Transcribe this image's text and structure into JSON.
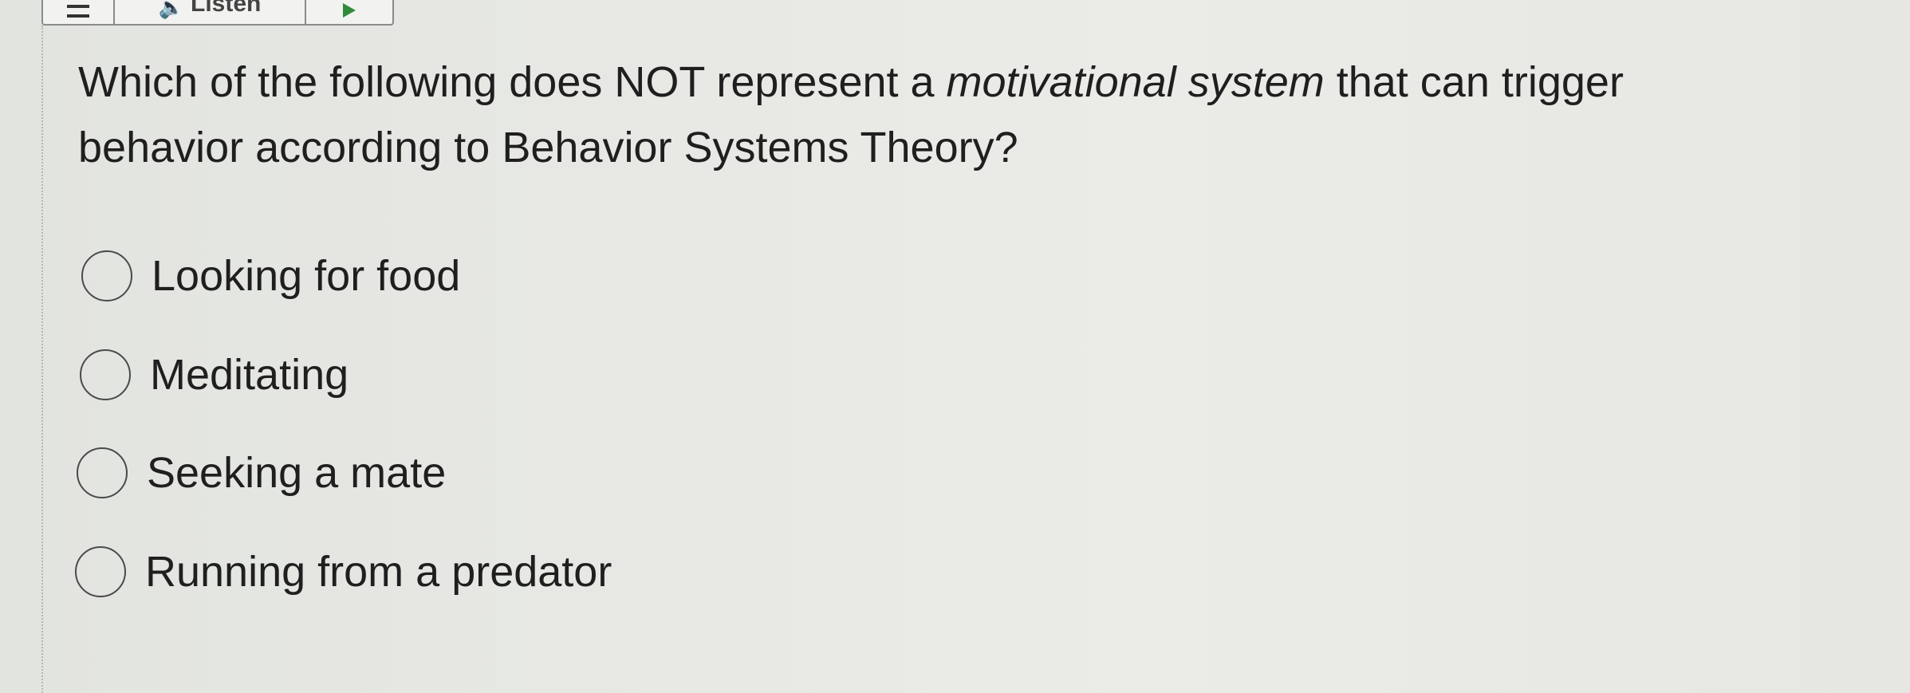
{
  "toolbar": {
    "menu_icon": "menu-icon",
    "listen_label": "Listen",
    "speaker_icon": "speaker-icon",
    "play_icon": "play-icon"
  },
  "question": {
    "text_before": "Which of the following does NOT represent a ",
    "emphasis": "motivational system",
    "text_after": " that can trigger behavior according to Behavior Systems Theory?"
  },
  "options": [
    {
      "label": "Looking for food",
      "selected": false
    },
    {
      "label": "Meditating",
      "selected": false
    },
    {
      "label": "Seeking a mate",
      "selected": false
    },
    {
      "label": "Running from a predator",
      "selected": false
    }
  ]
}
